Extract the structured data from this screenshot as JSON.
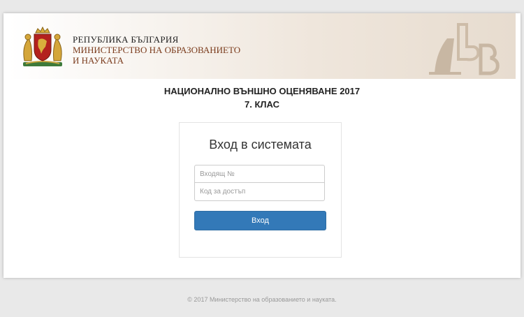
{
  "header": {
    "republic": "РЕПУБЛИКА БЪЛГАРИЯ",
    "ministry_line1": "МИНИСТЕРСТВО НА ОБРАЗОВАНИЕТО",
    "ministry_line2": "И НАУКАТА",
    "coat_icon": "bulgarian-coat-of-arms",
    "abv_icon": "abv-letters-decoration"
  },
  "exam": {
    "title": "НАЦИОНАЛНО ВЪНШНО ОЦЕНЯВАНЕ 2017",
    "grade": "7. КЛАС"
  },
  "login": {
    "title": "Вход в системата",
    "incoming_placeholder": "Входящ №",
    "incoming_value": "",
    "code_placeholder": "Код за достъп",
    "code_value": "",
    "button_label": "Вход",
    "button_color": "#3379b8"
  },
  "footer": {
    "copyright": "© 2017 Министерство на образованието и науката."
  }
}
